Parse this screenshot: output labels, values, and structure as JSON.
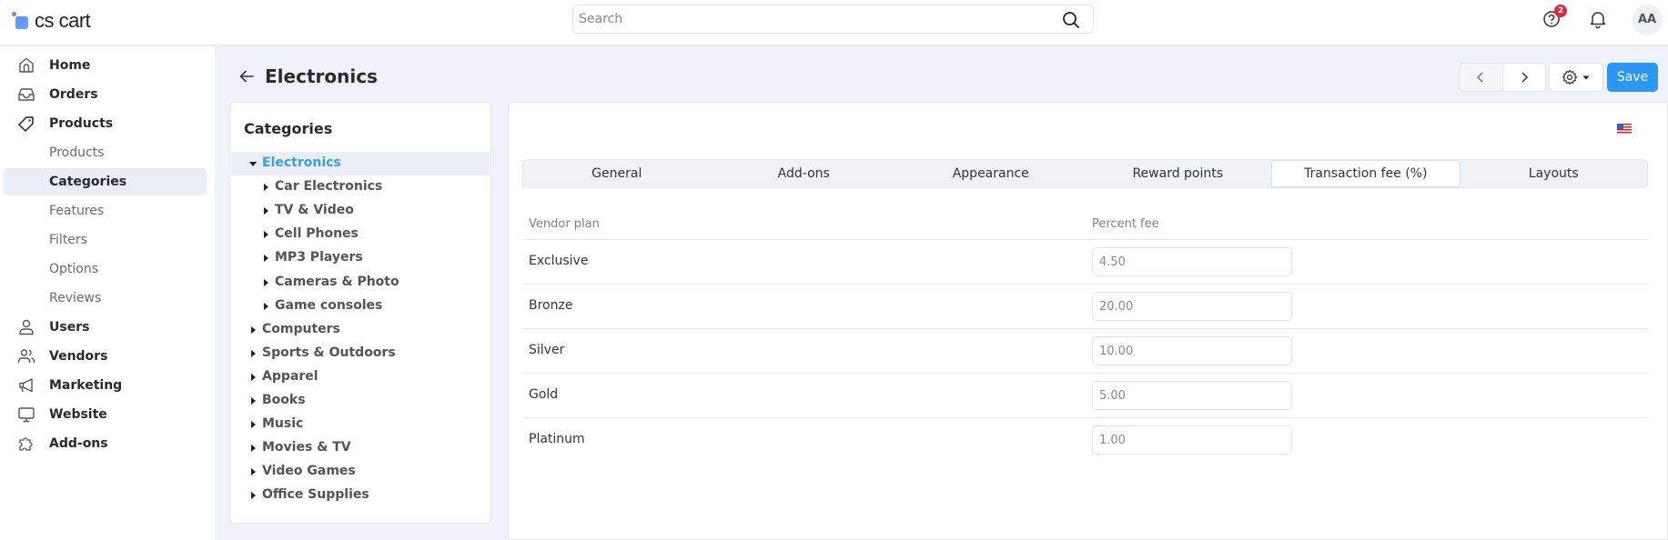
{
  "brand": {
    "name": "cs cart"
  },
  "topbar": {
    "search_placeholder": "Search",
    "help_badge_count": "2",
    "avatar_initials": "AA"
  },
  "sidebar": {
    "items": [
      {
        "label": "Home",
        "icon": "home-icon",
        "type": "main"
      },
      {
        "label": "Orders",
        "icon": "inbox-icon",
        "type": "main"
      },
      {
        "label": "Products",
        "icon": "tag-icon",
        "type": "main"
      },
      {
        "label": "Products",
        "type": "sub"
      },
      {
        "label": "Categories",
        "type": "sub",
        "active": true
      },
      {
        "label": "Features",
        "type": "sub"
      },
      {
        "label": "Filters",
        "type": "sub"
      },
      {
        "label": "Options",
        "type": "sub"
      },
      {
        "label": "Reviews",
        "type": "sub"
      },
      {
        "label": "Users",
        "icon": "user-icon",
        "type": "main"
      },
      {
        "label": "Vendors",
        "icon": "users-icon",
        "type": "main"
      },
      {
        "label": "Marketing",
        "icon": "megaphone-icon",
        "type": "main"
      },
      {
        "label": "Website",
        "icon": "monitor-icon",
        "type": "main"
      },
      {
        "label": "Add-ons",
        "icon": "puzzle-icon",
        "type": "main"
      }
    ]
  },
  "header": {
    "title": "Electronics",
    "save_label": "Save"
  },
  "categories": {
    "title": "Categories",
    "tree": [
      {
        "label": "Electronics",
        "level": 0,
        "expanded": true,
        "selected": true
      },
      {
        "label": "Car Electronics",
        "level": 1
      },
      {
        "label": "TV & Video",
        "level": 1
      },
      {
        "label": "Cell Phones",
        "level": 1
      },
      {
        "label": "MP3 Players",
        "level": 1
      },
      {
        "label": "Cameras & Photo",
        "level": 1
      },
      {
        "label": "Game consoles",
        "level": 1
      },
      {
        "label": "Computers",
        "level": 0
      },
      {
        "label": "Sports & Outdoors",
        "level": 0
      },
      {
        "label": "Apparel",
        "level": 0
      },
      {
        "label": "Books",
        "level": 0
      },
      {
        "label": "Music",
        "level": 0
      },
      {
        "label": "Movies & TV",
        "level": 0
      },
      {
        "label": "Video Games",
        "level": 0
      },
      {
        "label": "Office Supplies",
        "level": 0
      }
    ]
  },
  "tabs": [
    {
      "label": "General"
    },
    {
      "label": "Add-ons"
    },
    {
      "label": "Appearance"
    },
    {
      "label": "Reward points"
    },
    {
      "label": "Transaction fee (%)",
      "active": true
    },
    {
      "label": "Layouts"
    }
  ],
  "fee_table": {
    "columns": [
      "Vendor plan",
      "Percent fee"
    ],
    "rows": [
      {
        "plan": "Exclusive",
        "fee": "4.50"
      },
      {
        "plan": "Bronze",
        "fee": "20.00"
      },
      {
        "plan": "Silver",
        "fee": "10.00"
      },
      {
        "plan": "Gold",
        "fee": "5.00"
      },
      {
        "plan": "Platinum",
        "fee": "1.00"
      }
    ]
  },
  "colors": {
    "accent": "#2b98f5",
    "selected_category": "#3a9df0",
    "badge": "#e1253a"
  }
}
